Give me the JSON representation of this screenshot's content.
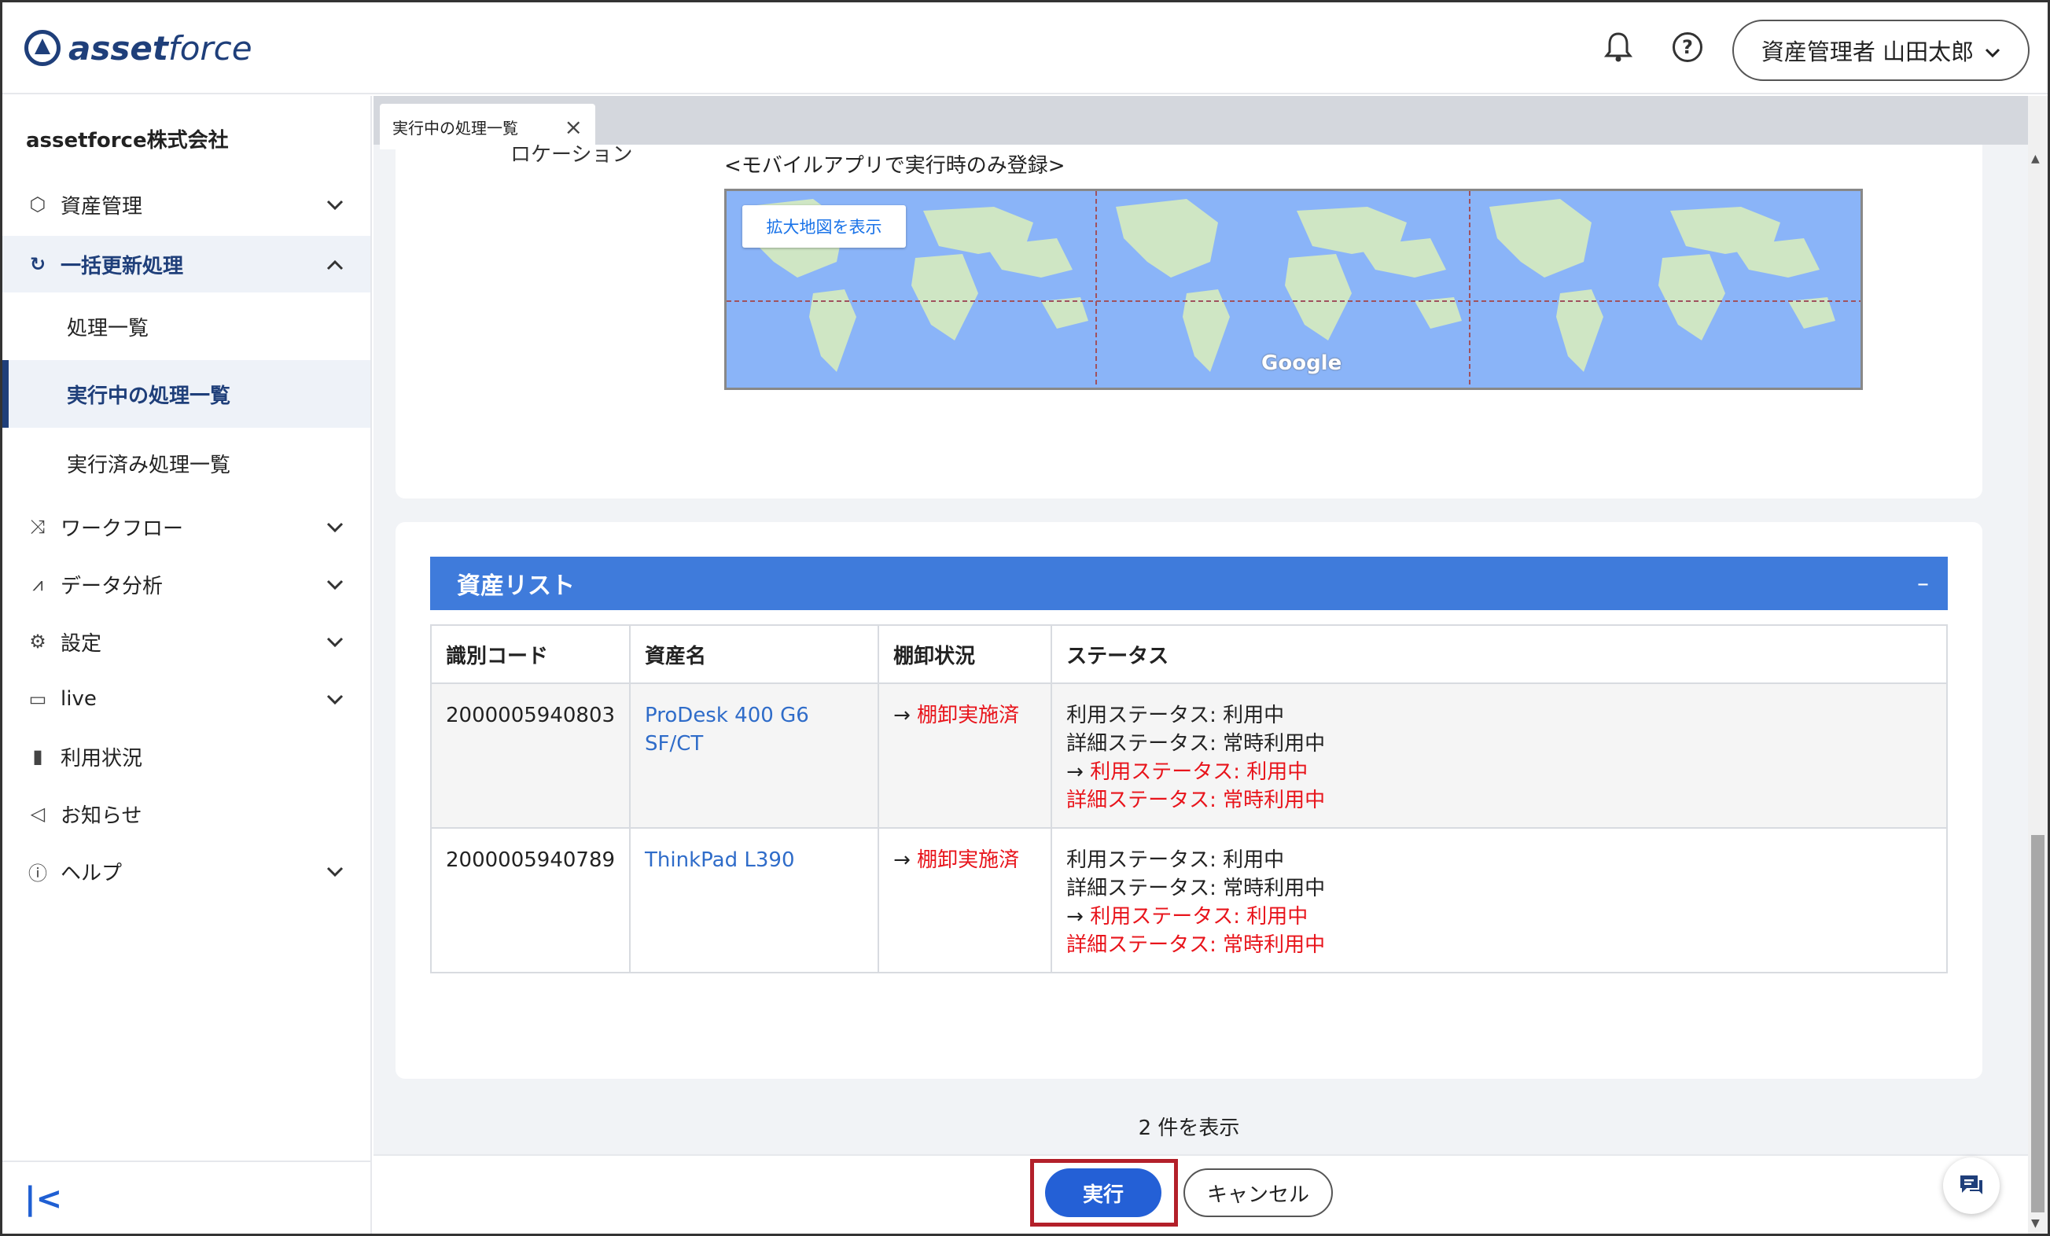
{
  "header": {
    "logo_bold": "asset",
    "logo_light": "force",
    "bell_icon": "bell-icon",
    "help_icon": "help-circle-icon",
    "user_label": "資産管理者 山田太郎"
  },
  "sidebar": {
    "company": "assetforce株式会社",
    "items": [
      {
        "label": "資産管理",
        "icon": "box-icon"
      },
      {
        "label": "一括更新処理",
        "icon": "refresh-icon"
      },
      {
        "label": "ワークフロー",
        "icon": "workflow-icon"
      },
      {
        "label": "データ分析",
        "icon": "analytics-icon"
      },
      {
        "label": "設定",
        "icon": "gear-icon"
      },
      {
        "label": "live",
        "icon": "live-icon"
      },
      {
        "label": "利用状況",
        "icon": "bar-chart-icon"
      },
      {
        "label": "お知らせ",
        "icon": "megaphone-icon"
      },
      {
        "label": "ヘルプ",
        "icon": "help-icon"
      }
    ],
    "sub_items": [
      {
        "label": "処理一覧"
      },
      {
        "label": "実行中の処理一覧"
      },
      {
        "label": "実行済み処理一覧"
      }
    ]
  },
  "tab": {
    "label": "実行中の処理一覧"
  },
  "location": {
    "label": "ロケーション",
    "note": "<モバイルアプリで実行時のみ登録>",
    "map_button": "拡大地図を表示",
    "map_brand": "Google"
  },
  "asset_list": {
    "title": "資産リスト",
    "collapse_symbol": "–",
    "columns": [
      "識別コード",
      "資産名",
      "棚卸状況",
      "ステータス"
    ],
    "rows": [
      {
        "code": "2000005940803",
        "name": "ProDesk 400 G6 SF/CT",
        "inventory_arrow": "→",
        "inventory": "棚卸実施済",
        "status_old_1": "利用ステータス: 利用中",
        "status_old_2": "詳細ステータス: 常時利用中",
        "status_arrow": "→",
        "status_new_1": "利用ステータス: 利用中",
        "status_new_2": "詳細ステータス: 常時利用中"
      },
      {
        "code": "2000005940789",
        "name": "ThinkPad L390",
        "inventory_arrow": "→",
        "inventory": "棚卸実施済",
        "status_old_1": "利用ステータス: 利用中",
        "status_old_2": "詳細ステータス: 常時利用中",
        "status_arrow": "→",
        "status_new_1": "利用ステータス: 利用中",
        "status_new_2": "詳細ステータス: 常時利用中"
      }
    ],
    "count_text": "2 件を表示"
  },
  "footer": {
    "execute": "実行",
    "cancel": "キャンセル"
  },
  "colors": {
    "brand": "#1f3f7a",
    "accent": "#3f7bdb",
    "button": "#2460d6",
    "highlight_red": "#e8141b"
  }
}
